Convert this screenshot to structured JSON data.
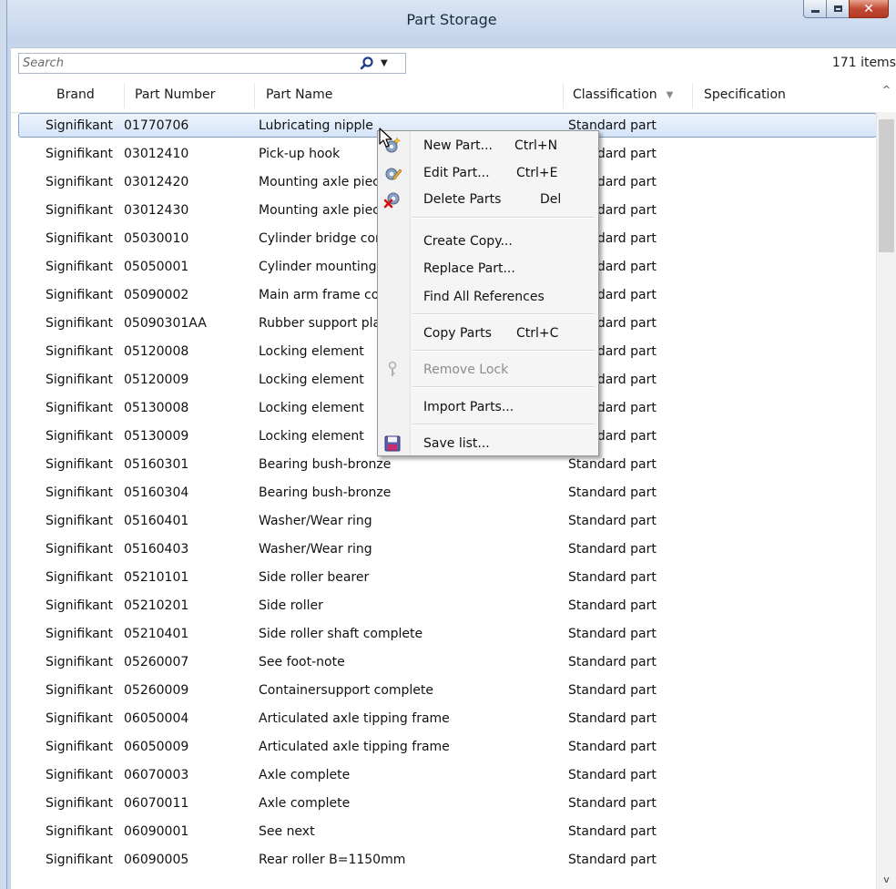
{
  "window": {
    "title": "Part Storage"
  },
  "toolbar": {
    "search_placeholder": "Search",
    "item_count": "171 items"
  },
  "columns": {
    "brand": "Brand",
    "part_number": "Part Number",
    "part_name": "Part Name",
    "classification": "Classification",
    "specification": "Specification"
  },
  "rows": [
    {
      "brand": "Signifikant",
      "number": "01770706",
      "name": "Lubricating nipple",
      "classification": "Standard part"
    },
    {
      "brand": "Signifikant",
      "number": "03012410",
      "name": "Pick-up hook",
      "classification": "Standard part"
    },
    {
      "brand": "Signifikant",
      "number": "03012420",
      "name": "Mounting axle piece",
      "classification": "Standard part"
    },
    {
      "brand": "Signifikant",
      "number": "03012430",
      "name": "Mounting axle piece",
      "classification": "Standard part"
    },
    {
      "brand": "Signifikant",
      "number": "05030010",
      "name": "Cylinder bridge complete",
      "classification": "Standard part"
    },
    {
      "brand": "Signifikant",
      "number": "05050001",
      "name": "Cylinder mounting",
      "classification": "Standard part"
    },
    {
      "brand": "Signifikant",
      "number": "05090002",
      "name": "Main arm frame complete",
      "classification": "Standard part"
    },
    {
      "brand": "Signifikant",
      "number": "05090301AA",
      "name": "Rubber support plate",
      "classification": "Standard part"
    },
    {
      "brand": "Signifikant",
      "number": "05120008",
      "name": "Locking element",
      "classification": "Standard part"
    },
    {
      "brand": "Signifikant",
      "number": "05120009",
      "name": "Locking element",
      "classification": "Standard part"
    },
    {
      "brand": "Signifikant",
      "number": "05130008",
      "name": "Locking element",
      "classification": "Standard part"
    },
    {
      "brand": "Signifikant",
      "number": "05130009",
      "name": "Locking element",
      "classification": "Standard part"
    },
    {
      "brand": "Signifikant",
      "number": "05160301",
      "name": "Bearing bush-bronze",
      "classification": "Standard part"
    },
    {
      "brand": "Signifikant",
      "number": "05160304",
      "name": "Bearing bush-bronze",
      "classification": "Standard part"
    },
    {
      "brand": "Signifikant",
      "number": "05160401",
      "name": "Washer/Wear ring",
      "classification": "Standard part"
    },
    {
      "brand": "Signifikant",
      "number": "05160403",
      "name": "Washer/Wear ring",
      "classification": "Standard part"
    },
    {
      "brand": "Signifikant",
      "number": "05210101",
      "name": "Side roller bearer",
      "classification": "Standard part"
    },
    {
      "brand": "Signifikant",
      "number": "05210201",
      "name": "Side roller",
      "classification": "Standard part"
    },
    {
      "brand": "Signifikant",
      "number": "05210401",
      "name": "Side roller shaft complete",
      "classification": "Standard part"
    },
    {
      "brand": "Signifikant",
      "number": "05260007",
      "name": "See foot-note",
      "classification": "Standard part"
    },
    {
      "brand": "Signifikant",
      "number": "05260009",
      "name": "Containersupport complete",
      "classification": "Standard part"
    },
    {
      "brand": "Signifikant",
      "number": "06050004",
      "name": "Articulated axle tipping frame",
      "classification": "Standard part"
    },
    {
      "brand": "Signifikant",
      "number": "06050009",
      "name": "Articulated axle tipping frame",
      "classification": "Standard part"
    },
    {
      "brand": "Signifikant",
      "number": "06070003",
      "name": "Axle complete",
      "classification": "Standard part"
    },
    {
      "brand": "Signifikant",
      "number": "06070011",
      "name": "Axle complete",
      "classification": "Standard part"
    },
    {
      "brand": "Signifikant",
      "number": "06090001",
      "name": "See next",
      "classification": "Standard part"
    },
    {
      "brand": "Signifikant",
      "number": "06090005",
      "name": "Rear roller B=1150mm",
      "classification": "Standard part"
    }
  ],
  "context_menu": {
    "items": [
      {
        "label": "New Part...",
        "shortcut": "Ctrl+N",
        "icon": "new-part-icon"
      },
      {
        "label": "Edit Part...",
        "shortcut": "Ctrl+E",
        "icon": "edit-part-icon"
      },
      {
        "label": "Delete Parts",
        "shortcut": "Del",
        "icon": "delete-parts-icon"
      },
      {
        "label": "Create Copy...",
        "shortcut": ""
      },
      {
        "label": "Replace Part...",
        "shortcut": ""
      },
      {
        "label": "Find All References",
        "shortcut": ""
      },
      {
        "label": "Copy Parts",
        "shortcut": "Ctrl+C"
      },
      {
        "label": "Remove Lock",
        "shortcut": "",
        "icon": "lock-icon",
        "disabled": true
      },
      {
        "label": "Import Parts...",
        "shortcut": ""
      },
      {
        "label": "Save list...",
        "shortcut": "",
        "icon": "save-icon"
      }
    ]
  }
}
